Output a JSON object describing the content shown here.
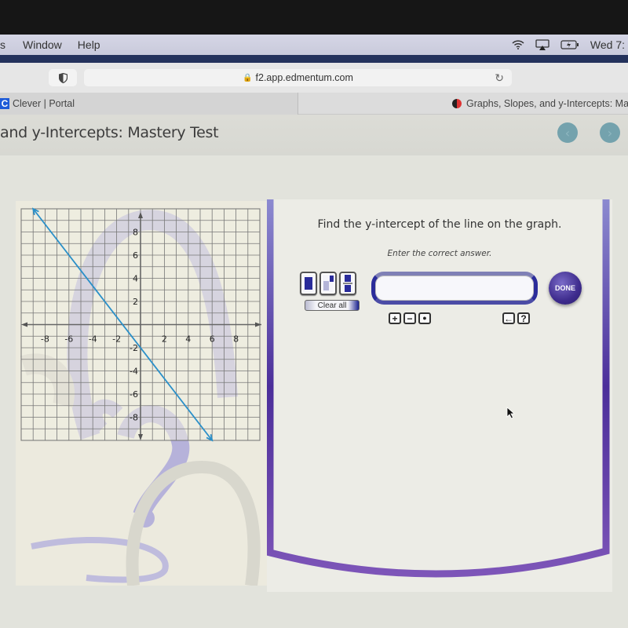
{
  "menubar": {
    "items": [
      "s",
      "Window",
      "Help"
    ],
    "clock": "Wed 7:",
    "status_icons": [
      "wifi-icon",
      "airplay-icon",
      "battery-charging-icon"
    ]
  },
  "browser": {
    "url": "f2.app.edmentum.com",
    "tabs": [
      {
        "label": "Clever | Portal",
        "icon": "clever-logo"
      },
      {
        "label": "Graphs, Slopes, and y-Intercepts: Maste",
        "icon": "edmentum-logo"
      }
    ]
  },
  "page": {
    "title": "and y-Intercepts: Mastery Test",
    "nav": {
      "prev": "‹",
      "next": "›"
    }
  },
  "question": {
    "prompt": "Find the y-intercept of the line on the graph.",
    "instruction": "Enter the correct answer.",
    "answer_value": "",
    "clear_all_label": "Clear all",
    "done_label": "DONE",
    "templates": [
      "single-box",
      "exponent",
      "fraction"
    ],
    "keys": {
      "plus": "+",
      "minus": "−",
      "dot": "●",
      "backspace": "←",
      "help": "?"
    }
  },
  "chart_data": {
    "type": "line",
    "title": "",
    "xlabel": "",
    "ylabel": "",
    "xlim": [
      -10,
      10
    ],
    "ylim": [
      -10,
      10
    ],
    "grid": true,
    "x_ticks": [
      -8,
      -6,
      -4,
      -2,
      2,
      4,
      6,
      8
    ],
    "y_ticks": [
      8,
      6,
      4,
      2,
      -2,
      -4,
      -6,
      -8
    ],
    "series": [
      {
        "name": "line",
        "color": "#2a8fc8",
        "points": [
          [
            -9,
            10
          ],
          [
            6,
            -10
          ]
        ],
        "slope": -1.3333,
        "y_intercept": -2,
        "arrows": "both"
      }
    ]
  }
}
